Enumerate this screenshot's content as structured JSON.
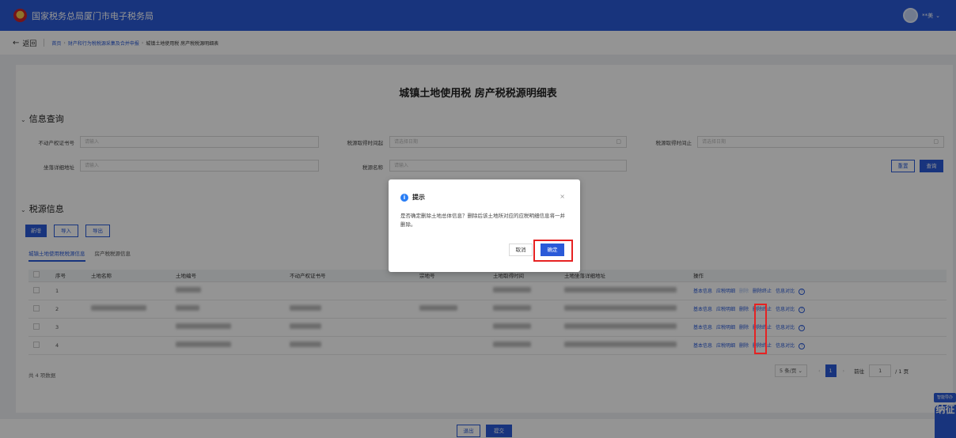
{
  "topbar": {
    "title": "国家税务总局厦门市电子税务局",
    "user_name": "**美"
  },
  "breadcrumb": {
    "back_label": "返回",
    "items": [
      "首页",
      "财产和行为税税源采集及合并申报",
      "城镇土地使用税 房产税税源明细表"
    ]
  },
  "page_title": "城镇土地使用税 房产税税源明细表",
  "query": {
    "section_title": "信息查询",
    "fields": [
      {
        "label": "不动产权证书号",
        "placeholder": "请输入"
      },
      {
        "label": "税源取得时间起",
        "placeholder": "请选择日期"
      },
      {
        "label": "税源取得时间止",
        "placeholder": "请选择日期"
      },
      {
        "label": "坐落详细地址",
        "placeholder": "请输入"
      },
      {
        "label": "税源名称",
        "placeholder": "请输入"
      }
    ],
    "reset_label": "重置",
    "search_label": "查询"
  },
  "source": {
    "section_title": "税源信息",
    "add_label": "新增",
    "import_label": "导入",
    "export_label": "导出",
    "tabs": [
      "城镇土地使用税税源信息",
      "房产税税源信息"
    ]
  },
  "table": {
    "headers": [
      "序号",
      "土地名称",
      "土地编号",
      "不动产权证书号",
      "宗地号",
      "土地取得时间",
      "土地坐落详细地址",
      "操作"
    ],
    "rows": [
      {
        "no": "1"
      },
      {
        "no": "2"
      },
      {
        "no": "3"
      },
      {
        "no": "4"
      }
    ],
    "ops": [
      "基本信息",
      "应税明细",
      "删除",
      "删除终止",
      "信息对比"
    ]
  },
  "pagination": {
    "total": "共 4 项数据",
    "per_page": "5 条/页",
    "current": "1",
    "goto_label": "前往",
    "goto_value": "1",
    "total_pages": "/ 1 页"
  },
  "bottom": {
    "back_label": "退出",
    "next_label": "提交"
  },
  "dialog": {
    "title": "提示",
    "close": "×",
    "message": "是否确定删除土地总体信息？删除后该土地所对应的应税明细信息将一并删除。",
    "cancel_label": "取消",
    "ok_label": "确定"
  },
  "float": {
    "badge": "智能导办",
    "mascot": "纳征"
  },
  "colors": {
    "primary": "#2a5ad8",
    "highlight": "#e62222"
  }
}
